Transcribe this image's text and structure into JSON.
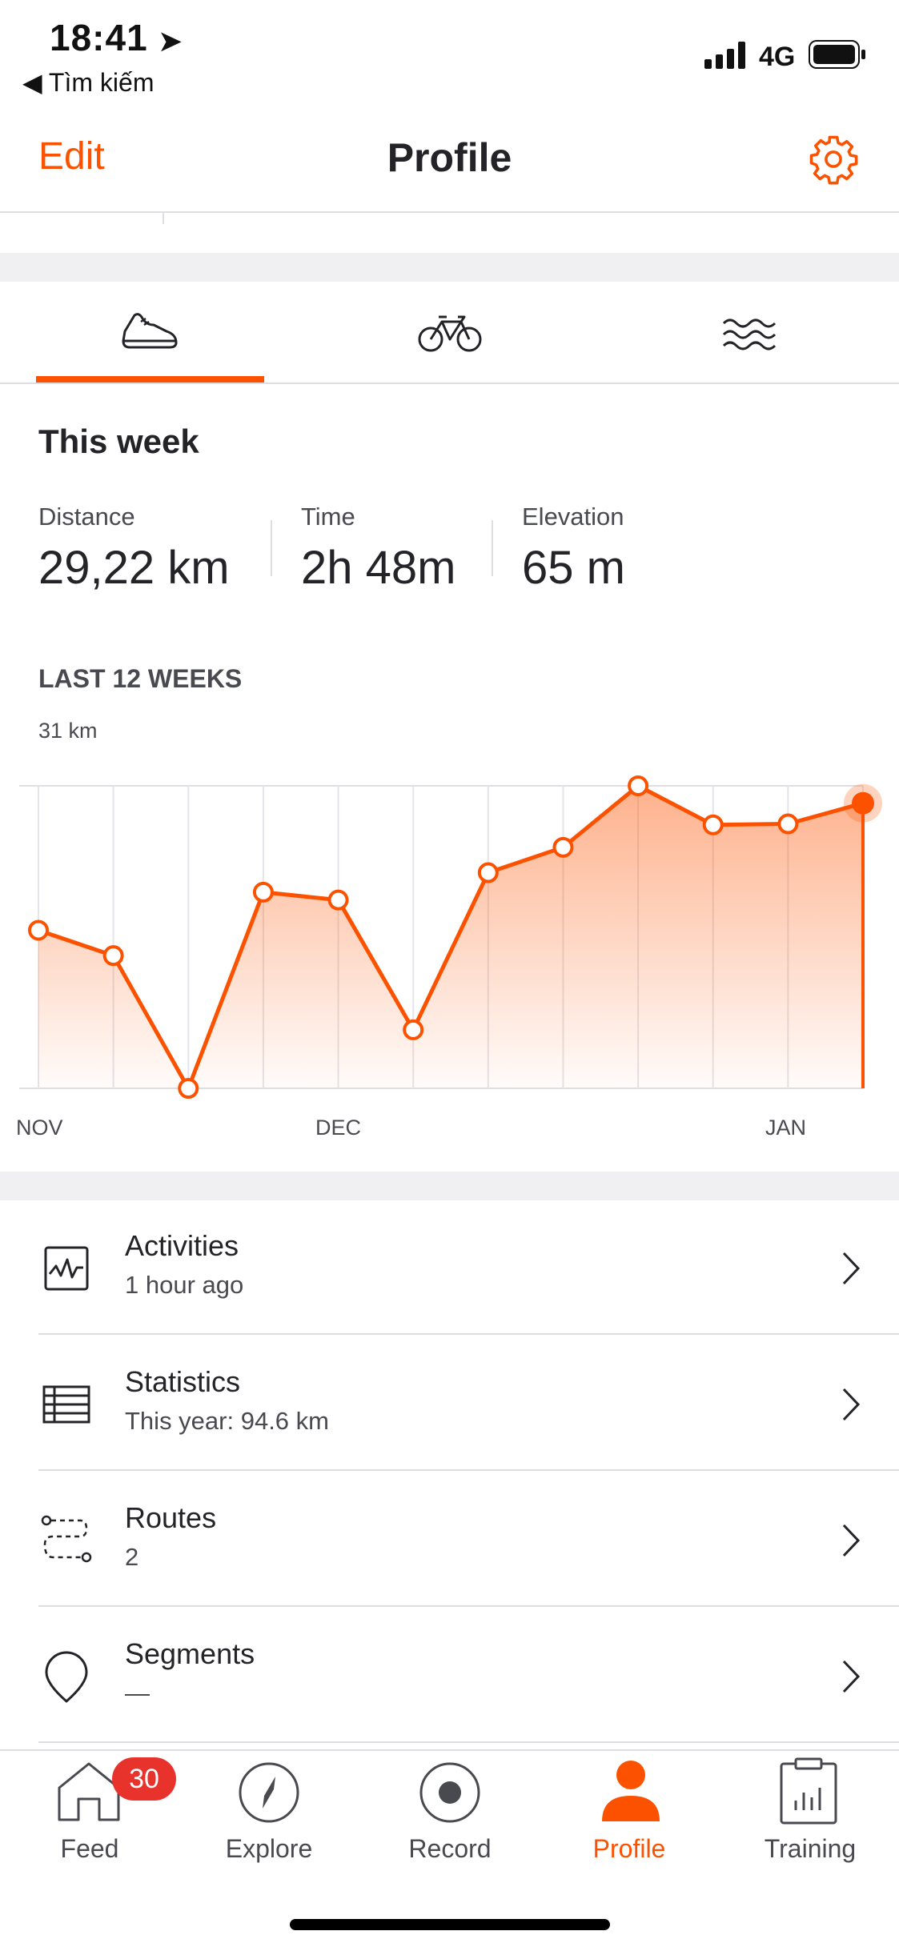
{
  "status_bar": {
    "time": "18:41",
    "back_label": "◀ Tìm kiếm",
    "network": "4G"
  },
  "header": {
    "edit_label": "Edit",
    "title": "Profile",
    "settings_icon": "gear-icon"
  },
  "sport_tabs": [
    {
      "icon": "running-shoe-icon",
      "selected": true
    },
    {
      "icon": "bicycle-icon",
      "selected": false
    },
    {
      "icon": "swim-waves-icon",
      "selected": false
    }
  ],
  "week": {
    "title": "This week",
    "stats": [
      {
        "label": "Distance",
        "value": "29,22 km"
      },
      {
        "label": "Time",
        "value": "2h 48m"
      },
      {
        "label": "Elevation",
        "value": "65 m"
      }
    ]
  },
  "chart_data": {
    "type": "area",
    "title": "LAST 12 WEEKS",
    "ylabel": "31 km",
    "ylim": [
      0,
      31
    ],
    "x_labels": [
      "NOV",
      "DEC",
      "JAN"
    ],
    "values": [
      16.2,
      13.6,
      0,
      20.1,
      19.3,
      6.0,
      22.1,
      24.7,
      31.0,
      27.0,
      27.1,
      29.22
    ],
    "accent_color": "#fc5200"
  },
  "menu": [
    {
      "title": "Activities",
      "subtitle": "1 hour ago",
      "icon": "activity-chart-icon"
    },
    {
      "title": "Statistics",
      "subtitle": "This year: 94.6 km",
      "icon": "table-icon"
    },
    {
      "title": "Routes",
      "subtitle": "2",
      "icon": "route-icon"
    },
    {
      "title": "Segments",
      "subtitle": "—",
      "icon": "segment-pin-icon"
    }
  ],
  "tabbar": {
    "items": [
      {
        "label": "Feed",
        "icon": "home-icon",
        "badge": "30"
      },
      {
        "label": "Explore",
        "icon": "compass-icon"
      },
      {
        "label": "Record",
        "icon": "record-icon"
      },
      {
        "label": "Profile",
        "icon": "person-icon",
        "active": true
      },
      {
        "label": "Training",
        "icon": "clipboard-chart-icon"
      }
    ]
  }
}
